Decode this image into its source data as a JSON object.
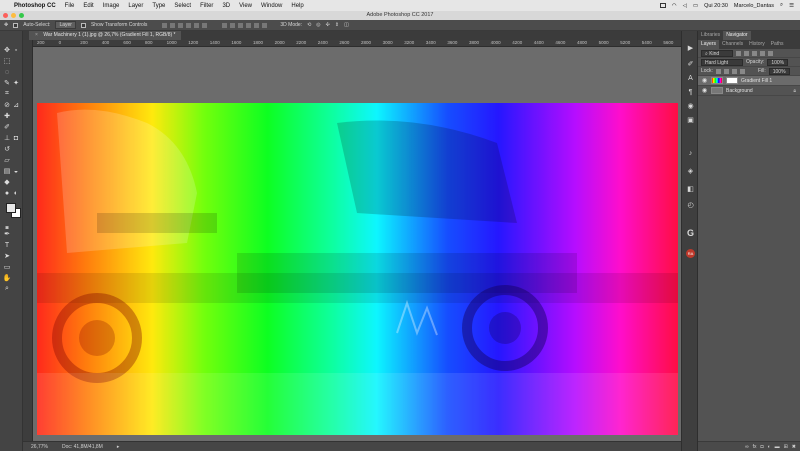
{
  "menubar": {
    "app_name": "Photoshop CC",
    "items": [
      "File",
      "Edit",
      "Image",
      "Layer",
      "Type",
      "Select",
      "Filter",
      "3D",
      "View",
      "Window",
      "Help"
    ],
    "clock": "Qui 20:30",
    "user": "Marcelo_Dantas"
  },
  "window": {
    "title": "Adobe Photoshop CC 2017"
  },
  "options_bar": {
    "auto_select_label": "Auto-Select:",
    "auto_select_value": "Layer",
    "transform_label": "Show Transform Controls",
    "mode_3d": "3D Mode:"
  },
  "document_tab": {
    "title": "War Machinery 1 (1).jpg @ 26,7% (Gradient Fill 1, RGB/8) *"
  },
  "ruler": {
    "ticks": [
      "200",
      "0",
      "200",
      "400",
      "600",
      "800",
      "1000",
      "1200",
      "1400",
      "1600",
      "1800",
      "2000",
      "2200",
      "2400",
      "2600",
      "2800",
      "3000",
      "3200",
      "3400",
      "3600",
      "3800",
      "4000",
      "4200",
      "4400",
      "4600",
      "4800",
      "5000",
      "5200",
      "5400",
      "5600"
    ]
  },
  "status_bar": {
    "zoom": "26,77%",
    "doc": "Doc: 41,8M/41,8M"
  },
  "panels": {
    "top_tabs": [
      "Libraries",
      "Navigator"
    ],
    "layer_tabs": [
      "Layers",
      "Channels",
      "History",
      "Paths"
    ],
    "kind_filter": "Kind",
    "blend_mode": "Hard Light",
    "opacity_label": "Opacity:",
    "opacity_value": "100%",
    "lock_label": "Lock:",
    "fill_label": "Fill:",
    "fill_value": "100%",
    "layers": [
      {
        "name": "Gradient Fill 1"
      },
      {
        "name": "Background"
      }
    ]
  },
  "colors": {
    "menubar": "#e6e6e6",
    "workspace": "#6c6c6c",
    "panel": "#535353",
    "selected_layer": "#6b6b6b"
  },
  "icons": {
    "dock": [
      "play-icon",
      "brush-panel-icon",
      "character-icon",
      "paragraph-icon",
      "adjustments-icon",
      "styles-icon",
      "glyphs-icon",
      "3d-icon",
      "timeline-icon",
      "g-extension-icon",
      "ra-extension-icon"
    ],
    "tools": [
      "move-icon",
      "marquee-icon",
      "lasso-icon",
      "quick-select-icon",
      "crop-icon",
      "eyedropper-icon",
      "healing-icon",
      "brush-icon",
      "stamp-icon",
      "history-brush-icon",
      "eraser-icon",
      "gradient-icon",
      "blur-icon",
      "dodge-icon",
      "pen-icon",
      "type-icon",
      "path-select-icon",
      "shape-icon",
      "hand-icon",
      "zoom-icon"
    ]
  }
}
